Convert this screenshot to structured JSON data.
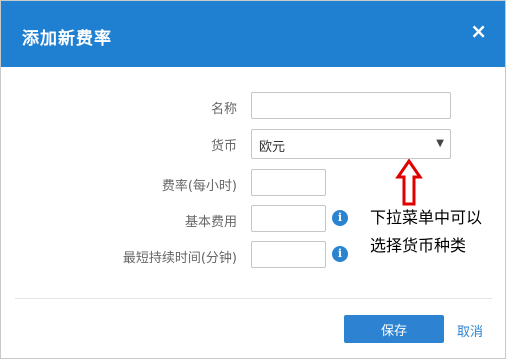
{
  "dialog": {
    "title": "添加新费率",
    "close_glyph": "×"
  },
  "form": {
    "name": {
      "label": "名称",
      "value": ""
    },
    "currency": {
      "label": "货币",
      "selected": "欧元",
      "arrow_glyph": "▼"
    },
    "rate": {
      "label": "费率(每小时)",
      "value": ""
    },
    "base_fee": {
      "label": "基本费用",
      "value": "",
      "info_glyph": "i"
    },
    "min_duration": {
      "label": "最短持续时间(分钟)",
      "value": "",
      "info_glyph": "i"
    }
  },
  "annotation": {
    "line1": "下拉菜单中可以",
    "line2": "选择货币种类",
    "arrow_color": "#e00000"
  },
  "footer": {
    "save_label": "保存",
    "cancel_label": "取消"
  },
  "colors": {
    "header": "#1f7fd1",
    "primary": "#2d83d1"
  },
  "icons": {
    "close": "close-icon",
    "info": "info-icon",
    "dropdown": "chevron-down-icon",
    "annotation_arrow": "arrow-up-icon"
  }
}
